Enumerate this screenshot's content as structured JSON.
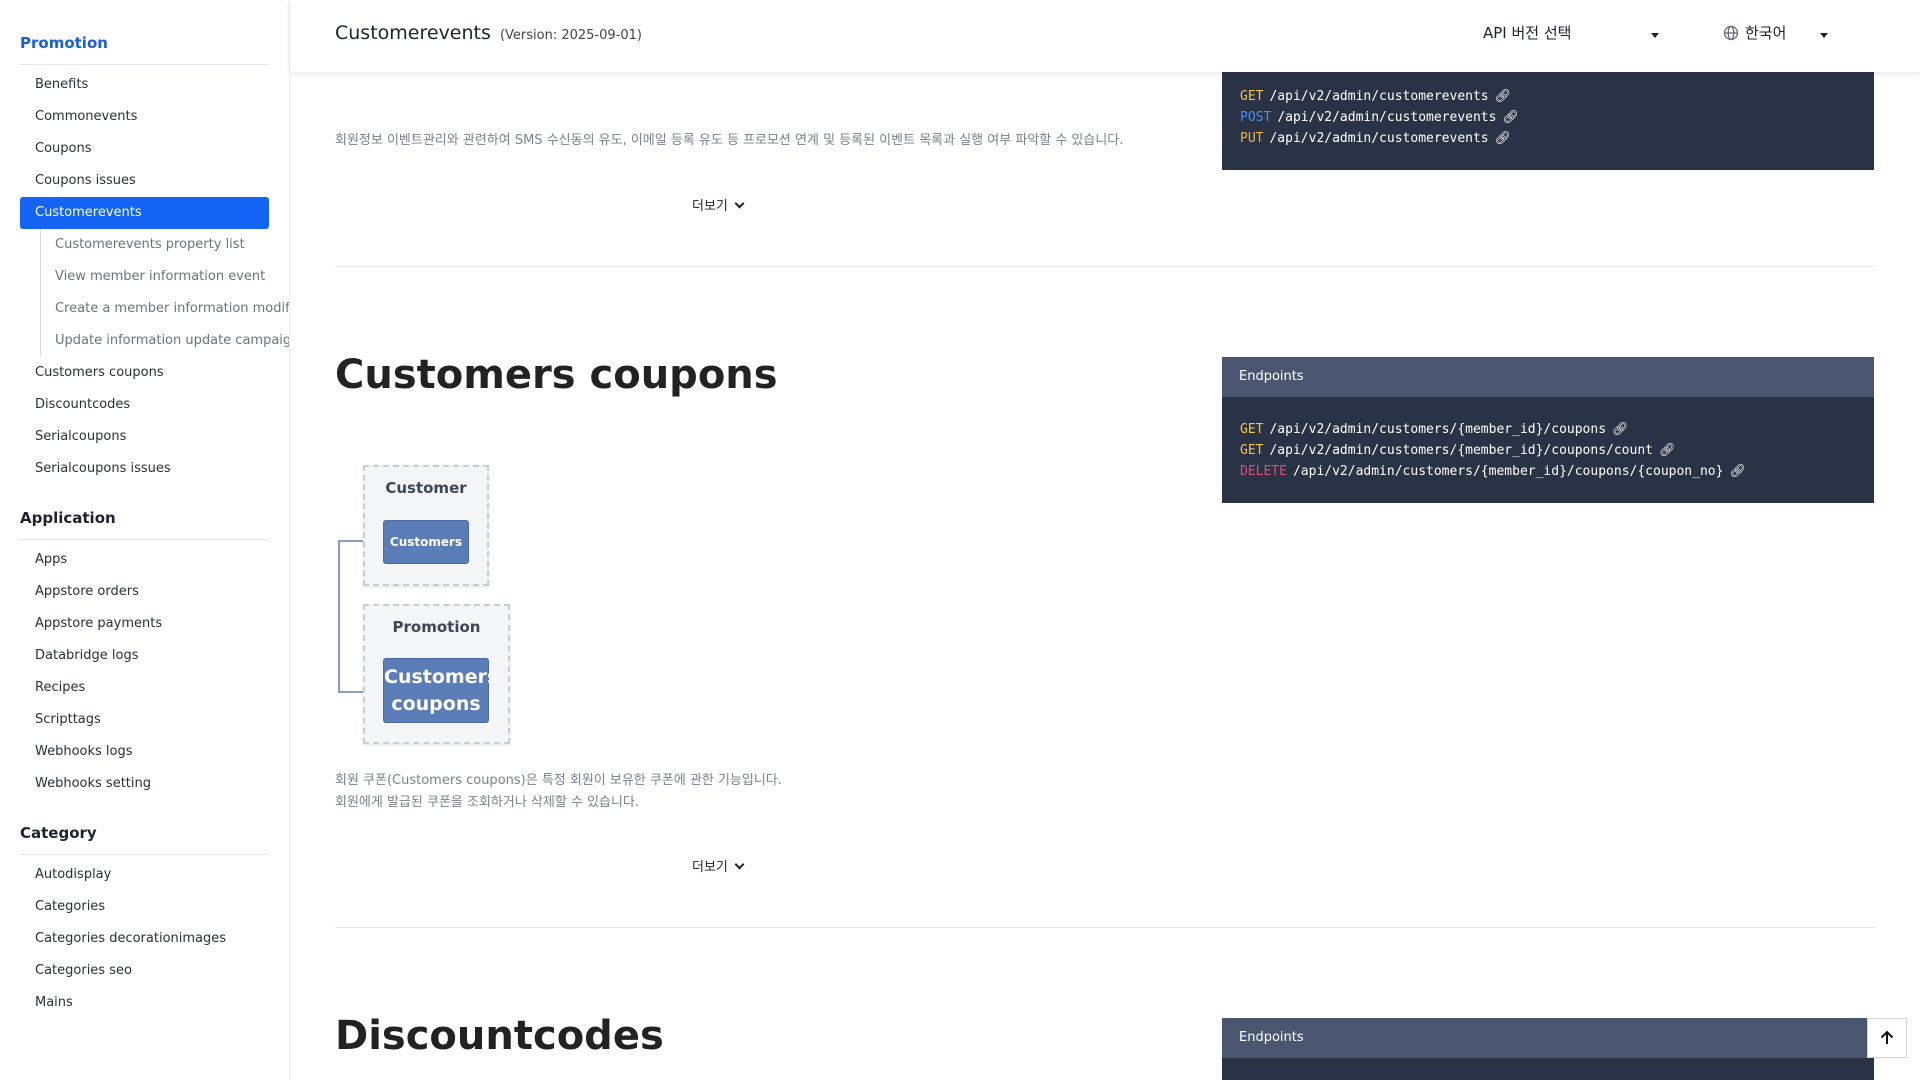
{
  "sidebar": {
    "groups": [
      {
        "title": "Promotion",
        "items": [
          "Benefits",
          "Commonevents",
          "Coupons",
          "Coupons issues",
          "Customerevents"
        ],
        "selected": "Customerevents",
        "sub_items": [
          "Customerevents property list",
          "View member information event",
          "Create a member information modifi",
          "Update information update campaigi"
        ],
        "items_after": [
          "Customers coupons",
          "Discountcodes",
          "Serialcoupons",
          "Serialcoupons issues"
        ]
      },
      {
        "title": "Application",
        "items": [
          "Apps",
          "Appstore orders",
          "Appstore payments",
          "Databridge logs",
          "Recipes",
          "Scripttags",
          "Webhooks logs",
          "Webhooks setting"
        ]
      },
      {
        "title": "Category",
        "items": [
          "Autodisplay",
          "Categories",
          "Categories decorationimages",
          "Categories seo",
          "Mains"
        ]
      }
    ]
  },
  "header": {
    "title": "Customerevents",
    "version": "(Version: 2025-09-01)",
    "api_select": "API 버전 선택",
    "language": "한국어",
    "language_icon": "globe-icon"
  },
  "customerevents": {
    "description": "회원정보 이벤트관리와 관련하여 SMS 수신동의 유도, 이메일 등록 유도 등 프로모션 연계 및 등록된 이벤트 목록과 실행 여부 파악할 수 있습니다.",
    "more": "더보기",
    "endpoints": [
      {
        "method": "GET",
        "path": "/api/v2/admin/customerevents"
      },
      {
        "method": "POST",
        "path": "/api/v2/admin/customerevents"
      },
      {
        "method": "PUT",
        "path": "/api/v2/admin/customerevents"
      }
    ]
  },
  "customers_coupons": {
    "title": "Customers coupons",
    "endpoints_header": "Endpoints",
    "endpoints": [
      {
        "method": "GET",
        "path": "/api/v2/admin/customers/{member_id}/coupons"
      },
      {
        "method": "GET",
        "path": "/api/v2/admin/customers/{member_id}/coupons/count"
      },
      {
        "method": "DELETE",
        "path": "/api/v2/admin/customers/{member_id}/coupons/{coupon_no}"
      }
    ],
    "diagram": {
      "box1_label": "Customer",
      "box1_node": "Customers",
      "box2_label": "Promotion",
      "box2_node": "Customers coupons"
    },
    "description_line1": "회원 쿠폰(Customers coupons)은 특정 회원이 보유한 쿠폰에 관한 기능입니다.",
    "description_line2": "회원에게 발급된 쿠폰을 조회하거나 삭제할 수 있습니다.",
    "more": "더보기"
  },
  "discountcodes": {
    "title": "Discountcodes",
    "endpoints_header": "Endpoints"
  },
  "colors": {
    "accent": "#1465f6",
    "get": "#f6c343",
    "post": "#4d8ef7",
    "delete": "#e84c6b",
    "endpoint_bg": "#2a3245",
    "endpoint_header": "#4a5570"
  }
}
